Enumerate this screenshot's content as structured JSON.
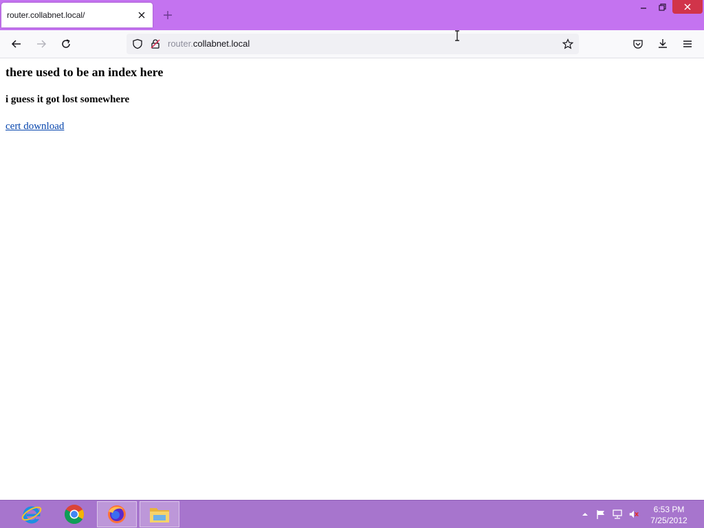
{
  "browser": {
    "tab": {
      "title": "router.collabnet.local/"
    },
    "urlbar": {
      "host_prefix": "router.",
      "host_main": "collabnet.local"
    }
  },
  "page": {
    "heading": "there used to be an index here",
    "subheading": "i guess it got lost somewhere",
    "link": "cert download"
  },
  "taskbar": {
    "apps": [
      "internet-explorer-icon",
      "chrome-icon",
      "firefox-icon",
      "file-explorer-icon"
    ],
    "clock": {
      "time": "6:53 PM",
      "date": "7/25/2012"
    }
  },
  "colors": {
    "titlebar": "#c473f0",
    "taskbar": "#a775cd",
    "close_button": "#d1344a",
    "link": "#0645ad"
  }
}
